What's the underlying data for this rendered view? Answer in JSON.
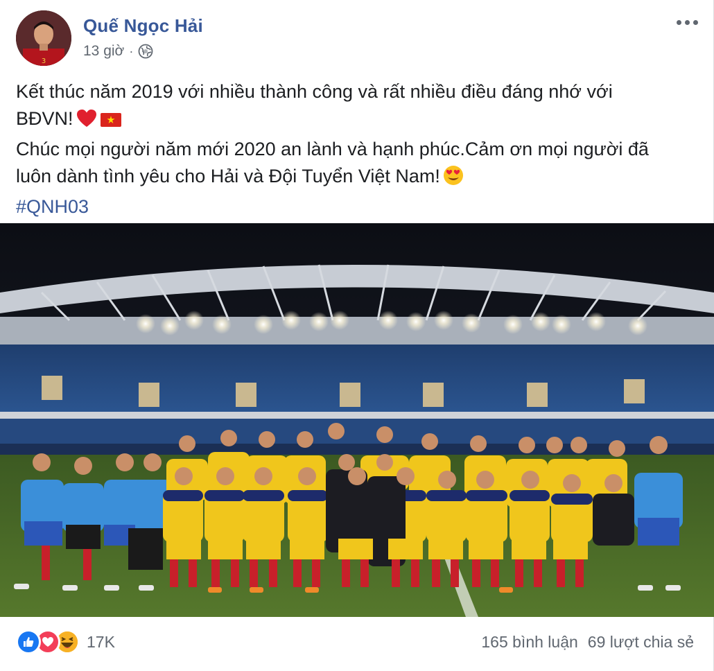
{
  "post": {
    "author": "Quế Ngọc Hải",
    "time": "13 giờ",
    "separator": "·",
    "privacy_icon": "globe-icon",
    "menu_icon": "more-options-icon",
    "text_line1": "Kết thúc năm 2019 với nhiều thành công và rất nhiều điều đáng nhớ với",
    "text_line2": "BĐVN!",
    "text_line3": "Chúc mọi người năm mới 2020 an lành và hạnh phúc.Cảm ơn mọi người đã",
    "text_line4": "luôn dành tình yêu cho Hải và Đội Tuyển Việt Nam!",
    "hashtag": "#QNH03",
    "emojis": [
      "red-heart-emoji",
      "vietnam-flag-emoji",
      "heart-eyes-emoji"
    ]
  },
  "photo": {
    "description_icon": "team-photo"
  },
  "footer": {
    "reaction_icons": [
      "like-icon",
      "love-icon",
      "haha-icon"
    ],
    "reaction_count": "17K",
    "comments": "165 bình luận",
    "shares": "69 lượt chia sẻ"
  },
  "colors": {
    "link": "#385898",
    "secondary": "#606770",
    "like": "#1877f2",
    "love": "#f33e58",
    "haha": "#f7b125"
  }
}
